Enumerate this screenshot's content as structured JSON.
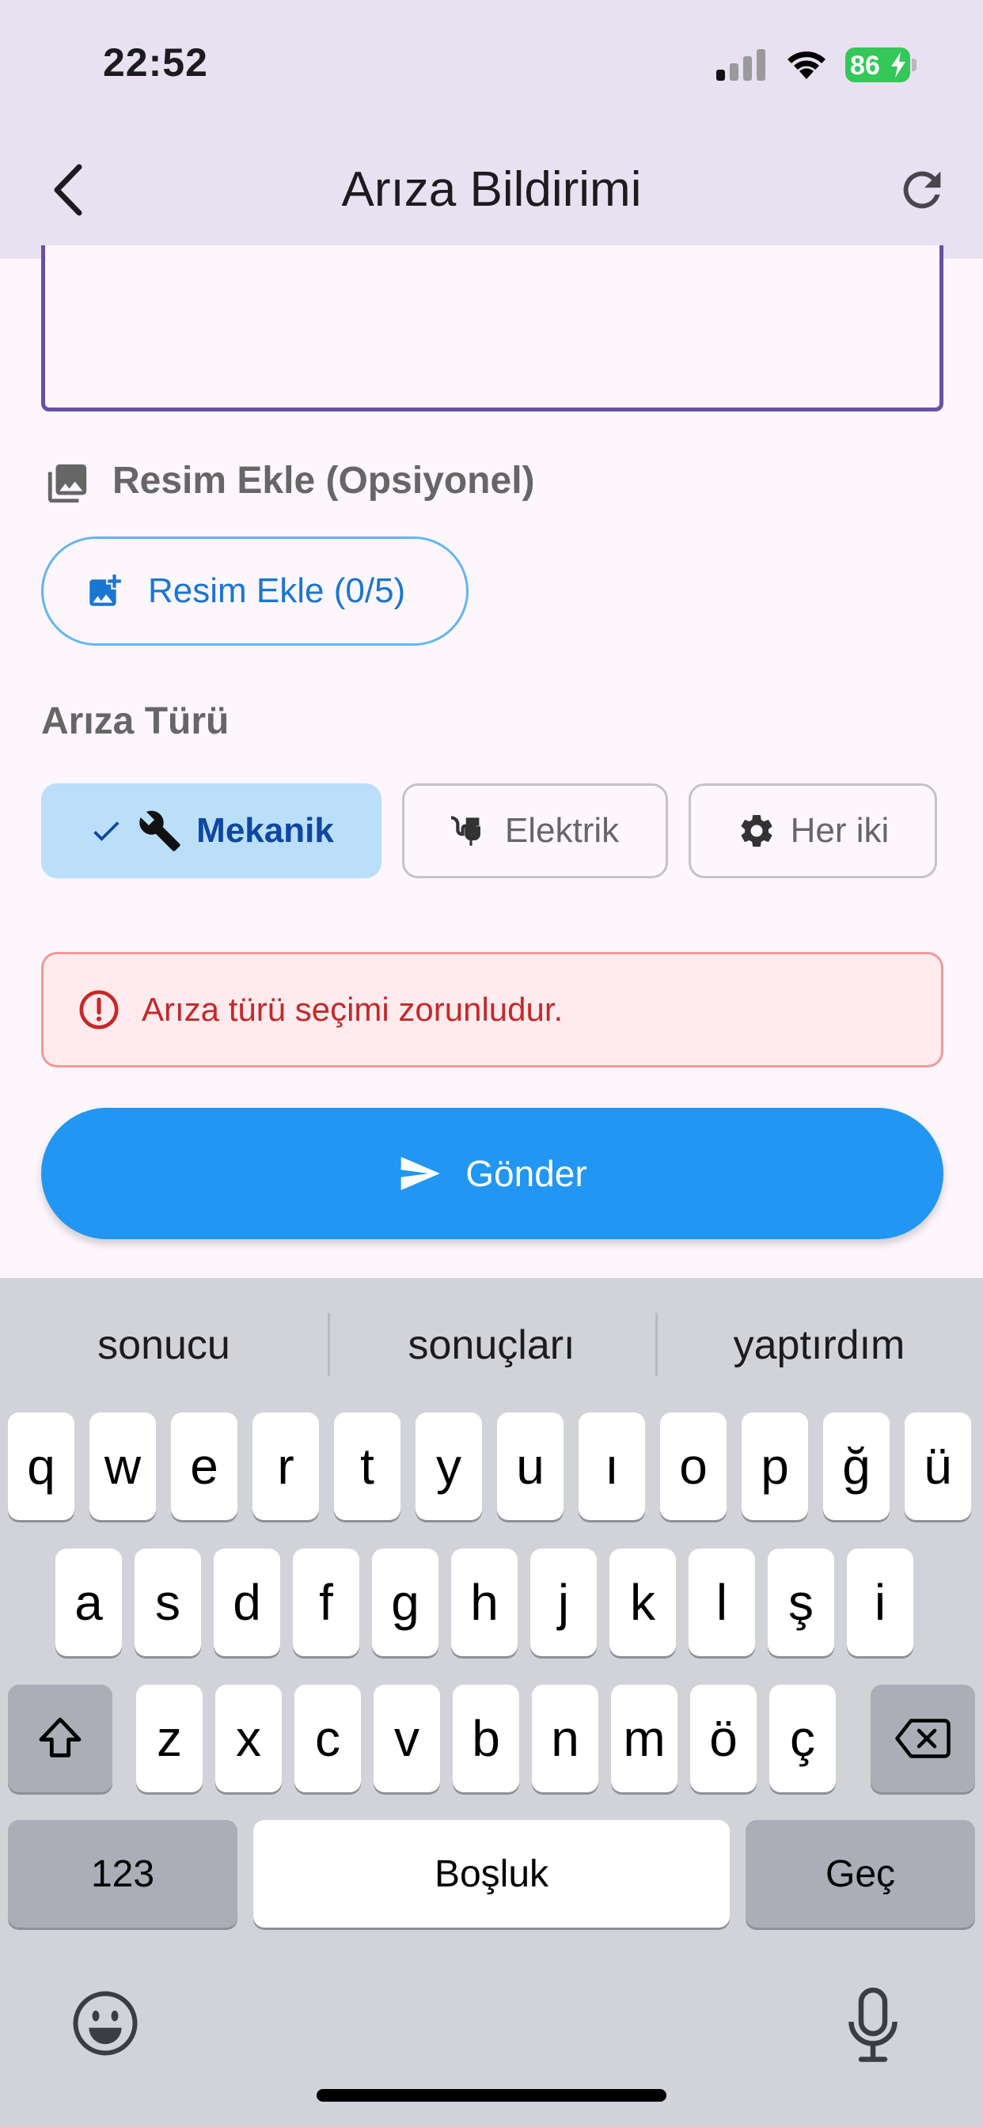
{
  "status_bar": {
    "time": "22:52",
    "battery": "86"
  },
  "app_bar": {
    "title": "Arıza Bildirimi"
  },
  "image_section": {
    "label": "Resim Ekle (Opsiyonel)",
    "button_label": "Resim Ekle (0/5)"
  },
  "fault_type": {
    "label": "Arıza Türü",
    "options": [
      {
        "label": "Mekanik",
        "selected": true
      },
      {
        "label": "Elektrik",
        "selected": false
      },
      {
        "label": "Her iki",
        "selected": false
      }
    ]
  },
  "error": {
    "message": "Arıza türü seçimi zorunludur."
  },
  "send_button": {
    "label": "Gönder"
  },
  "keyboard": {
    "suggestions": [
      "sonucu",
      "sonuçları",
      "yaptırdım"
    ],
    "row1": [
      "q",
      "w",
      "e",
      "r",
      "t",
      "y",
      "u",
      "ı",
      "o",
      "p",
      "ğ",
      "ü"
    ],
    "row2": [
      "a",
      "s",
      "d",
      "f",
      "g",
      "h",
      "j",
      "k",
      "l",
      "ş",
      "i"
    ],
    "row3": [
      "z",
      "x",
      "c",
      "v",
      "b",
      "n",
      "m",
      "ö",
      "ç"
    ],
    "numbers_label": "123",
    "space_label": "Boşluk",
    "return_label": "Geç"
  },
  "colors": {
    "accent": "#2196f3",
    "chip_selected": "#bbdefb",
    "error": "#c62828",
    "app_bar": "#e8e1f1"
  }
}
